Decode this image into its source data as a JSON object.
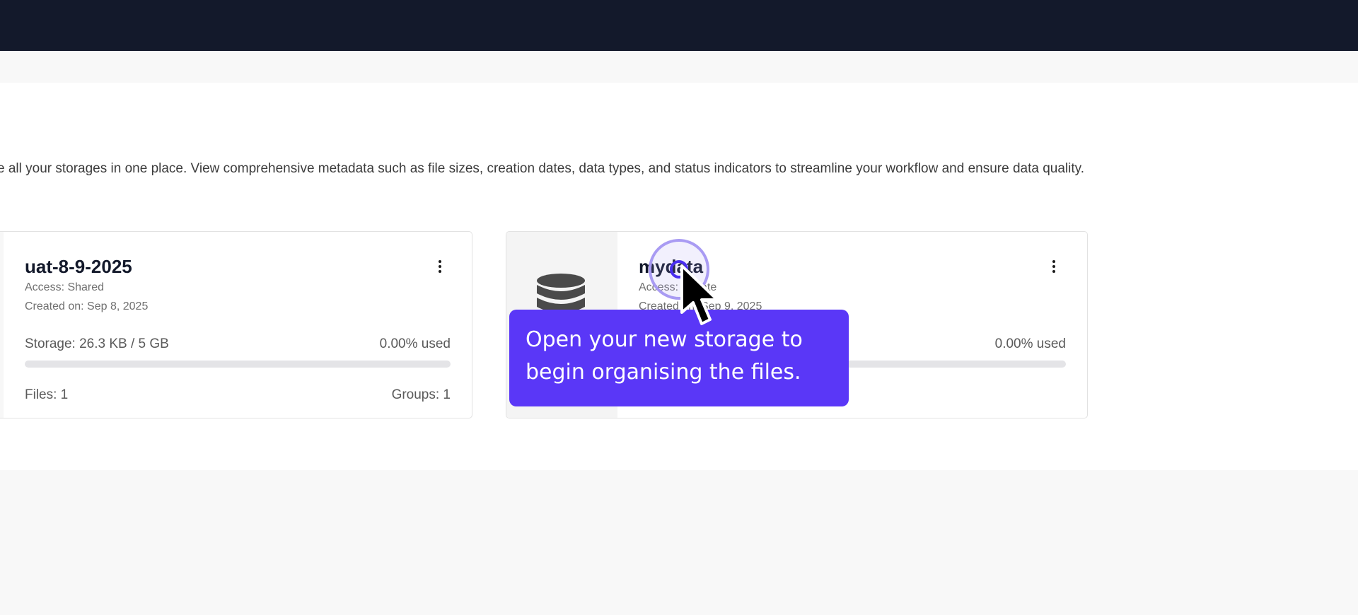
{
  "page": {
    "description": "e all your storages in one place. View comprehensive metadata such as file sizes, creation dates, data types, and status indicators to streamline your workflow and ensure data quality."
  },
  "storages": [
    {
      "name": "uat-8-9-2025",
      "access": "Access: Shared",
      "created": "Created on: Sep 8, 2025",
      "storage": "Storage: 26.3 KB / 5 GB",
      "used": "0.00% used",
      "used_fraction": 0.0,
      "files": "Files: 1",
      "groups": "Groups: 1"
    },
    {
      "name": "mydata",
      "access": "Access: Private",
      "created": "Created on: Sep 9, 2025",
      "used": "0.00% used",
      "used_fraction": 0.0,
      "icon": "database-icon"
    }
  ],
  "tooltip": {
    "text": "Open your new storage to begin organising the files."
  },
  "colors": {
    "topbar": "#13192b",
    "accent": "#5a37f7",
    "click_ring": "#a99bf3"
  }
}
